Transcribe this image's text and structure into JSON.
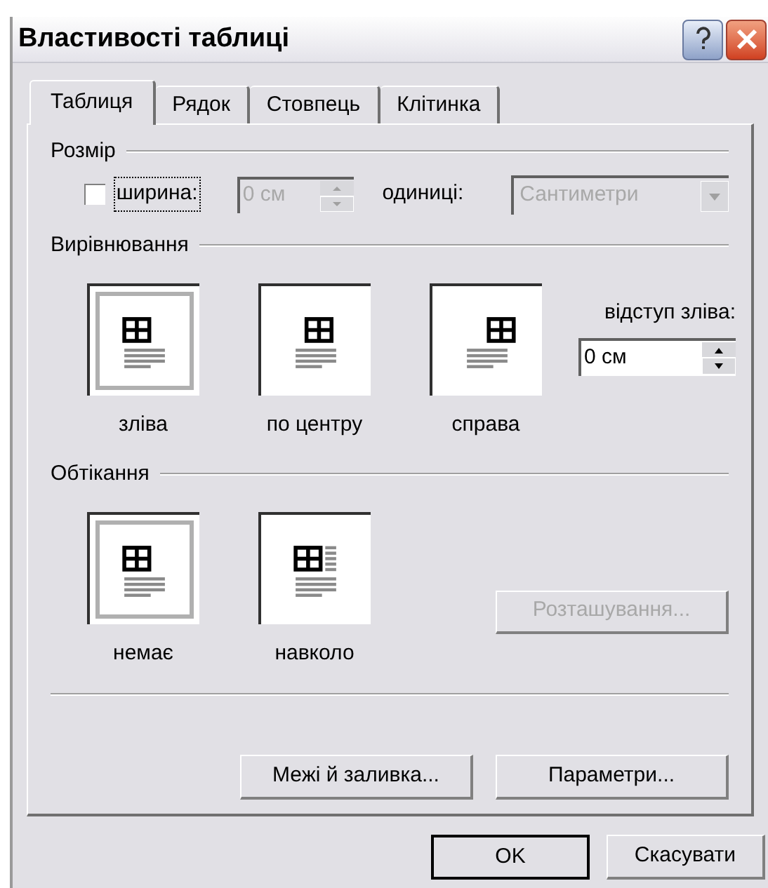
{
  "window": {
    "title": "Властивості таблиці"
  },
  "tabs": [
    {
      "label": "Таблиця",
      "selected": true
    },
    {
      "label": "Рядок",
      "selected": false
    },
    {
      "label": "Стовпець",
      "selected": false
    },
    {
      "label": "Клітинка",
      "selected": false
    }
  ],
  "size": {
    "heading": "Розмір",
    "width_checkbox": {
      "label": "ширина:",
      "checked": false
    },
    "width_field": {
      "value": "0 см",
      "disabled": true
    },
    "units_label": "одиниці:",
    "units_dropdown": {
      "value": "Сантиметри",
      "disabled": true
    }
  },
  "alignment": {
    "heading": "Вирівнювання",
    "options": [
      {
        "label": "зліва",
        "kind": "left",
        "selected": true
      },
      {
        "label": "по центру",
        "kind": "center",
        "selected": false
      },
      {
        "label": "справа",
        "kind": "right",
        "selected": false
      }
    ],
    "indent_label": "відступ зліва:",
    "indent_field": {
      "value": "0 см"
    }
  },
  "wrapping": {
    "heading": "Обтікання",
    "options": [
      {
        "label": "немає",
        "kind": "none",
        "selected": true
      },
      {
        "label": "навколо",
        "kind": "around",
        "selected": false
      }
    ],
    "position_button": {
      "label": "Розташування...",
      "disabled": true
    }
  },
  "panel_buttons": [
    {
      "label": "Межі й заливка..."
    },
    {
      "label": "Параметри..."
    }
  ],
  "buttons": [
    {
      "label": "OK",
      "default": true
    },
    {
      "label": "Скасувати",
      "default": false
    }
  ]
}
